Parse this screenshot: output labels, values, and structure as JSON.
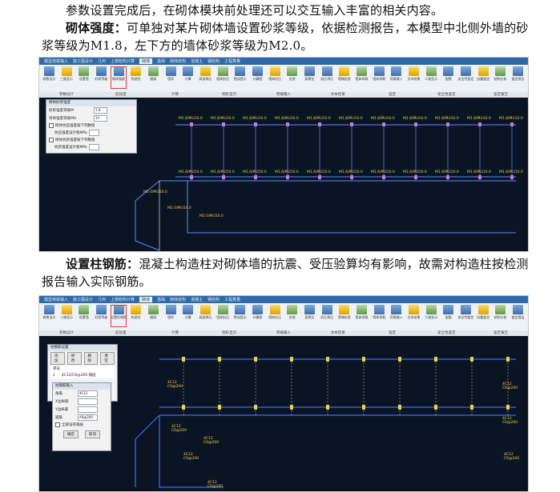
{
  "text": {
    "line1": "参数设置完成后，在砌体模块前处理还可以交互输入丰富的相关内容。",
    "p2_bold": "砌体强度：",
    "p2_rest": "可单独对某片砌体墙设置砂浆等级，依据检测报告，本模型中北侧外墙的砂浆等级为M1.8，左下方的墙体砂浆等级为M2.0。",
    "p3_bold": "设置柱钢筋：",
    "p3_rest": "混凝土构造柱对砌体墙的抗震、受压验算均有影响，故需对构造柱按检测报告输入实际钢筋。"
  },
  "screenshot1": {
    "menu_tabs": [
      "模型荷载输入",
      "施工图设计",
      "几何",
      "上部结构计算",
      "砌体",
      "基础",
      "砌体结构",
      "混凝土",
      "钢结构",
      "工程算量"
    ],
    "active_tab": "砌体",
    "ribbon_buttons": [
      "参数设计",
      "三维显示",
      "设置墙",
      "砂浆等级",
      "砌体强度",
      "构造柱",
      "圈梁",
      "墙垛",
      "计算",
      "局部承压",
      "墙体抗压",
      "错误提示",
      "计算图",
      "墙体抗压",
      "抗剪",
      "高厚比",
      "局压承压",
      "墙端抗剪",
      "墙体承载",
      "墙体承载",
      "荷载输入",
      "文本结果",
      "二维显示",
      "配筋",
      "安全性鉴定",
      "抗震鉴定",
      "结构分析",
      "鉴定报告"
    ],
    "highlight_button": "砌体强度",
    "group_labels": [
      "参数设计",
      "前处理",
      "计算",
      "图形显示",
      "荷载输入",
      "文本结果",
      "鉴定",
      "安全性鉴定",
      "鉴定报告"
    ],
    "dialog": {
      "title": "砌体砂浆强度",
      "rows": [
        {
          "label": "砂浆强度等级M",
          "value": "1.8"
        },
        {
          "label": "块体强度等级MU",
          "value": "10"
        }
      ],
      "checks": [
        "砌体抗压强度按下列数值",
        "抗压强度设计值MPa",
        "砌体抗剪强度按下列数值",
        "抗剪强度设计值MPa"
      ]
    },
    "wall_labels": [
      "M1.8/MU10.0",
      "M2.0/MU10.0"
    ]
  },
  "screenshot2": {
    "menu_tabs": [
      "模型荷载输入",
      "施工图设计",
      "几何",
      "上部结构计算",
      "砌体",
      "基础",
      "砌体结构",
      "混凝土",
      "钢结构",
      "工程算量"
    ],
    "active_tab": "砌体",
    "highlight_button": "设置柱钢筋",
    "group_labels": [
      "参数设计",
      "前处理",
      "计算",
      "图形显示",
      "荷载输入",
      "文本结果",
      "鉴定",
      "安全性鉴定",
      "鉴定报告"
    ],
    "list_dialog": {
      "title": "柱钢筋设置",
      "buttons": [
        "添加",
        "修改",
        "删除",
        "清空"
      ],
      "header": "序号",
      "row": [
        "1",
        "4C12/C6@200 隔层"
      ]
    },
    "input_dialog": {
      "title": "柱钢筋输入",
      "fields": [
        {
          "label": "角筋",
          "value": "4C12"
        },
        {
          "label": "X边纵筋",
          "value": ""
        },
        {
          "label": "Y边纵筋",
          "value": ""
        },
        {
          "label": "箍筋",
          "value": "A6@200"
        }
      ],
      "check": "全部设有隔层",
      "ok": "确定",
      "cancel": "取消"
    },
    "col_labels": [
      "4C12",
      "C6@200"
    ]
  }
}
